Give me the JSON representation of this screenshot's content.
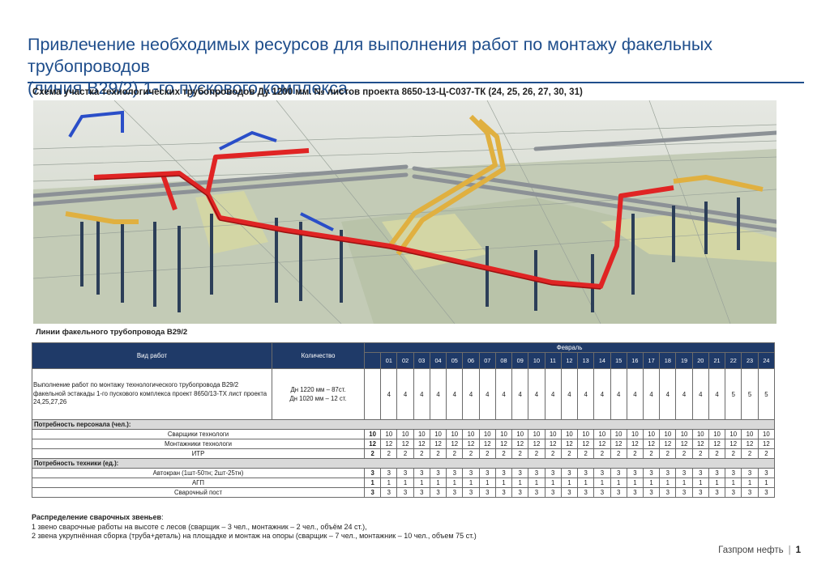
{
  "title": {
    "line1": "Привлечение необходимых ресурсов для выполнения работ по монтажу факельных трубопроводов",
    "line2": "(линия В29/2) 1-го пускового комплекса."
  },
  "subtitle": "Схема участка технологических трубопроводов Ду 1200 мм. № листов проекта 8650-13-Ц-С037-ТК (24, 25, 26, 27, 30, 31)",
  "caption": "Линии факельного трубопровода В29/2",
  "table": {
    "col_work": "Вид работ",
    "col_qty": "Количество",
    "month": "Февраль",
    "days": [
      "01",
      "02",
      "03",
      "04",
      "05",
      "06",
      "07",
      "08",
      "09",
      "10",
      "11",
      "12",
      "13",
      "14",
      "15",
      "16",
      "17",
      "18",
      "19",
      "20",
      "21",
      "22",
      "23",
      "24"
    ],
    "main_row": {
      "work": "Выполнение работ по монтажу технологического трубопровода В29/2 факельной эстакады 1-го пускового комплекса проект 8650/13-ТХ лист проекта 24,25,27,26",
      "qty_line1": "Дн 1220 мм – 87ст.",
      "qty_line2": "Дн 1020 мм – 12 ст.",
      "values": [
        "4",
        "4",
        "4",
        "4",
        "4",
        "4",
        "4",
        "4",
        "4",
        "4",
        "4",
        "4",
        "4",
        "4",
        "4",
        "4",
        "4",
        "4",
        "4",
        "4",
        "4",
        "5",
        "5",
        "5"
      ]
    },
    "section_personnel": "Потребность персонала (чел.):",
    "personnel": [
      {
        "label": "Сварщики технологи",
        "values": [
          "10",
          "10",
          "10",
          "10",
          "10",
          "10",
          "10",
          "10",
          "10",
          "10",
          "10",
          "10",
          "10",
          "10",
          "10",
          "10",
          "10",
          "10",
          "10",
          "10",
          "10",
          "10",
          "10",
          "10",
          "10"
        ]
      },
      {
        "label": "Монтажники технологи",
        "values": [
          "12",
          "12",
          "12",
          "12",
          "12",
          "12",
          "12",
          "12",
          "12",
          "12",
          "12",
          "12",
          "12",
          "12",
          "12",
          "12",
          "12",
          "12",
          "12",
          "12",
          "12",
          "12",
          "12",
          "12",
          "12"
        ]
      },
      {
        "label": "ИТР",
        "values": [
          "2",
          "2",
          "2",
          "2",
          "2",
          "2",
          "2",
          "2",
          "2",
          "2",
          "2",
          "2",
          "2",
          "2",
          "2",
          "2",
          "2",
          "2",
          "2",
          "2",
          "2",
          "2",
          "2",
          "2",
          "2"
        ]
      }
    ],
    "section_equipment": "Потребность техники (ед.):",
    "equipment": [
      {
        "label": "Автокран (1шт-50тн; 2шт-25тн)",
        "values": [
          "3",
          "3",
          "3",
          "3",
          "3",
          "3",
          "3",
          "3",
          "3",
          "3",
          "3",
          "3",
          "3",
          "3",
          "3",
          "3",
          "3",
          "3",
          "3",
          "3",
          "3",
          "3",
          "3",
          "3",
          "3"
        ]
      },
      {
        "label": "АГП",
        "values": [
          "1",
          "1",
          "1",
          "1",
          "1",
          "1",
          "1",
          "1",
          "1",
          "1",
          "1",
          "1",
          "1",
          "1",
          "1",
          "1",
          "1",
          "1",
          "1",
          "1",
          "1",
          "1",
          "1",
          "1",
          "1"
        ]
      },
      {
        "label": "Сварочный пост",
        "values": [
          "3",
          "3",
          "3",
          "3",
          "3",
          "3",
          "3",
          "3",
          "3",
          "3",
          "3",
          "3",
          "3",
          "3",
          "3",
          "3",
          "3",
          "3",
          "3",
          "3",
          "3",
          "3",
          "3",
          "3",
          "3"
        ]
      }
    ]
  },
  "notes": {
    "heading": "Распределение сварочных звеньев",
    "heading_suffix": ":",
    "line1": "1 звено сварочные работы на высоте с лесов (сварщик – 3 чел., монтажник – 2 чел., объём 24 ст.),",
    "line2": "2 звена укрупнённая сборка (труба+деталь) на площадке и монтаж на опоры (сварщик – 7 чел., монтажник – 10 чел., объем 75 ст.)"
  },
  "footer": {
    "company": "Газпром нефть",
    "separator": "|",
    "page": "1"
  },
  "colors": {
    "brand_blue": "#1f4e8c",
    "header_navy": "#1f3a68",
    "pipe_red": "#e02424",
    "pipe_yellow": "#e0b040",
    "pipe_blue": "#2a4ec8"
  }
}
